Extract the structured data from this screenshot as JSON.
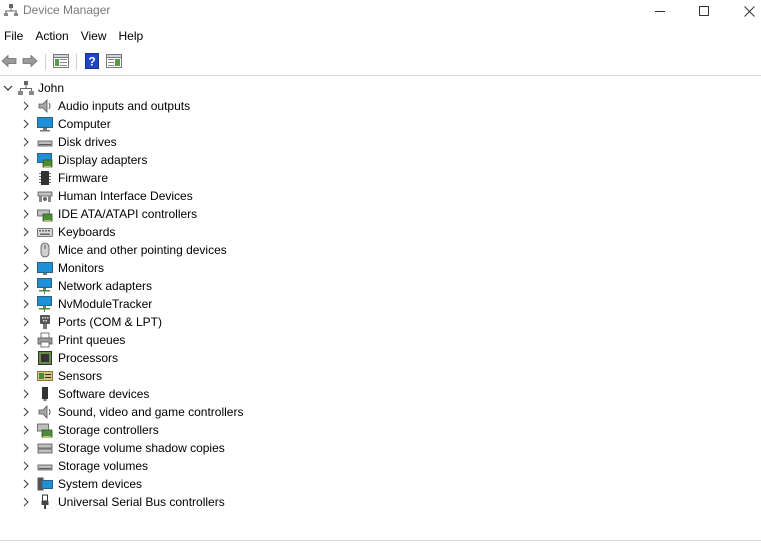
{
  "window": {
    "title": "Device Manager"
  },
  "menu": [
    {
      "label": "File"
    },
    {
      "label": "Action"
    },
    {
      "label": "View"
    },
    {
      "label": "Help"
    }
  ],
  "toolbar": [
    "back-icon",
    "forward-icon",
    "show-hide-tree-icon",
    "help-icon",
    "properties-icon"
  ],
  "tree": {
    "root": {
      "label": "John",
      "icon": "computer-user-icon",
      "expanded": true
    },
    "categories": [
      {
        "label": "Audio inputs and outputs",
        "icon": "speaker-icon"
      },
      {
        "label": "Computer",
        "icon": "computer-icon"
      },
      {
        "label": "Disk drives",
        "icon": "disk-drive-icon"
      },
      {
        "label": "Display adapters",
        "icon": "display-adapter-icon"
      },
      {
        "label": "Firmware",
        "icon": "firmware-icon"
      },
      {
        "label": "Human Interface Devices",
        "icon": "hid-icon"
      },
      {
        "label": "IDE ATA/ATAPI controllers",
        "icon": "ide-controller-icon"
      },
      {
        "label": "Keyboards",
        "icon": "keyboard-icon"
      },
      {
        "label": "Mice and other pointing devices",
        "icon": "mouse-icon"
      },
      {
        "label": "Monitors",
        "icon": "monitor-icon"
      },
      {
        "label": "Network adapters",
        "icon": "network-adapter-icon"
      },
      {
        "label": "NvModuleTracker",
        "icon": "nvmodule-icon"
      },
      {
        "label": "Ports (COM & LPT)",
        "icon": "port-icon"
      },
      {
        "label": "Print queues",
        "icon": "printer-icon"
      },
      {
        "label": "Processors",
        "icon": "processor-icon"
      },
      {
        "label": "Sensors",
        "icon": "sensor-icon"
      },
      {
        "label": "Software devices",
        "icon": "software-device-icon"
      },
      {
        "label": "Sound, video and game controllers",
        "icon": "sound-controller-icon"
      },
      {
        "label": "Storage controllers",
        "icon": "storage-controller-icon"
      },
      {
        "label": "Storage volume shadow copies",
        "icon": "shadow-copy-icon"
      },
      {
        "label": "Storage volumes",
        "icon": "storage-volume-icon"
      },
      {
        "label": "System devices",
        "icon": "system-device-icon"
      },
      {
        "label": "Universal Serial Bus controllers",
        "icon": "usb-icon"
      }
    ]
  },
  "colors": {
    "title_text": "#7a7a7a",
    "accent_blue": "#1e90d8",
    "help_blue": "#2046c8"
  }
}
